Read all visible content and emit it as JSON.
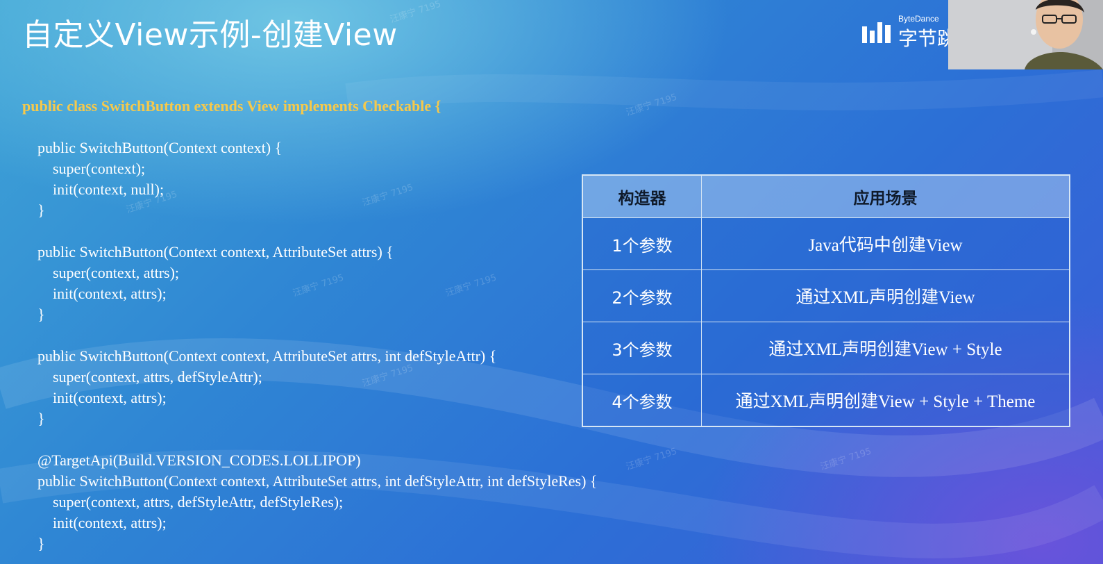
{
  "slide": {
    "title": "自定义View示例-创建View"
  },
  "brand": {
    "name_en": "ByteDance",
    "name_cn": "字节跳动"
  },
  "watermark": "汪康宁 7195",
  "code_lines": [
    "public class SwitchButton extends View implements Checkable {",
    "",
    "    public SwitchButton(Context context) {",
    "        super(context);",
    "        init(context, null);",
    "    }",
    "",
    "    public SwitchButton(Context context, AttributeSet attrs) {",
    "        super(context, attrs);",
    "        init(context, attrs);",
    "    }",
    "",
    "    public SwitchButton(Context context, AttributeSet attrs, int defStyleAttr) {",
    "        super(context, attrs, defStyleAttr);",
    "        init(context, attrs);",
    "    }",
    "",
    "    @TargetApi(Build.VERSION_CODES.LOLLIPOP)",
    "    public SwitchButton(Context context, AttributeSet attrs, int defStyleAttr, int defStyleRes) {",
    "        super(context, attrs, defStyleAttr, defStyleRes);",
    "        init(context, attrs);",
    "    }"
  ],
  "table": {
    "headers": [
      "构造器",
      "应用场景"
    ],
    "rows": [
      [
        "1个参数",
        "Java代码中创建View"
      ],
      [
        "2个参数",
        "通过XML声明创建View"
      ],
      [
        "3个参数",
        "通过XML声明创建View + Style"
      ],
      [
        "4个参数",
        "通过XML声明创建View + Style + Theme"
      ]
    ]
  },
  "colors": {
    "code_highlight": "#f6c94b",
    "table_border": "#d6e6f5"
  }
}
